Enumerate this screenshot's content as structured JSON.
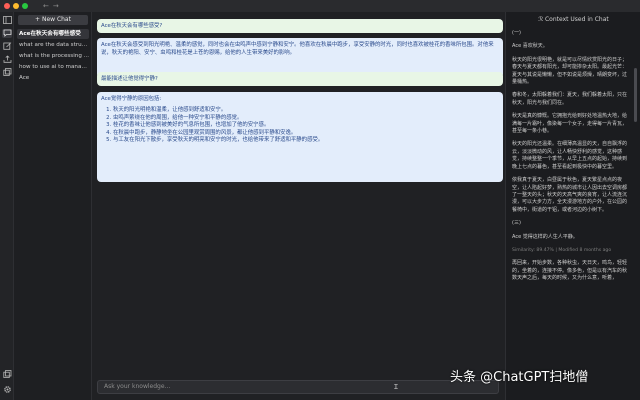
{
  "window": {
    "back_arrow": "←",
    "forward_arrow": "→"
  },
  "rail": {
    "icons": [
      "sidebar-icon",
      "chat-icon",
      "edit-icon",
      "upload-icon",
      "copy-icon"
    ],
    "bottom_icons": [
      "copy-icon",
      "gear-icon"
    ]
  },
  "sidebar": {
    "new_chat_label": "+ New Chat",
    "items": [
      {
        "label": "Ace在秋天会有哪些感受"
      },
      {
        "label": "what are the data struc..."
      },
      {
        "label": "what is the processing ..."
      },
      {
        "label": "how to use ai to manag..."
      },
      {
        "label": "Ace"
      }
    ]
  },
  "main": {
    "q1": "Ace在秋天会有哪些感受?",
    "a1": "Ace在秋天会感受到阳光明艳、温柔的感觉，同时也会在虫鸣声中感到宁静和安宁。他喜欢在秋晨中跑步，享受安静的时光，同时也喜欢被桂花的香味所包围。对他来说，秋天的艳阳、安宁、虫鸣和桂花是上苍的恩赐，给他的人生带来美好的影响。",
    "q2": "最能描述让他觉得宁静?",
    "a2_intro": "Ace觉得宁静的原因包括:",
    "a2_list": [
      "秋天的阳光明艳和温柔，让他感到舒适和安宁。",
      "虫鸣声萦绕在他的周围，给他一种安宁和平静的感觉。",
      "桂花的香味让他感到被美好的气息所包围，也增加了他的安宁感。",
      "在秋晨中跑步，静静地坐在公园里观赏周围的风景，都让他感到平静和安逸。",
      "与工友在阳光下散步，享受秋天的明亮和安宁的时光，也给他带来了舒适和平静的感受。"
    ],
    "input_placeholder": "Ask your knowledge...",
    "cursor": "Ɪ"
  },
  "context": {
    "header": "Context Used in Chat",
    "header_icon": "ℛ",
    "paragraphs": [
      "(一)",
      "Ace 喜欢秋天。",
      "秋天的阳光很明艳，就是可以尽情欣赏阳光的日子；春天与夏天都有阳光，却可能掺杂太阳。最起光芒：夏天与其说是懒懒，但不如说是烦燥，晴朗变坏，过量桶热。",
      "春和冬，太阳躲着我们：夏天，我们躲着太阳，只在秋天，阳光与我们同在。",
      "秋天是真的慷慨。它拥抱光给到好处地温热大地，给满每一片霜叶，像染每一个女子，走得每一片青瓦，甚至每一条小巷。",
      "秋天的阳光还温柔。在细薄高温显的天，自自飘浮的云，淡淡微动的风，让人畅快舒利的感觉，这种感觉，持续整整一个季节，从早上五点的起始，持续到晚上七点的暮色，甚至看起到极快中的暮空里。",
      "依我真于夏天，白昼属于秋色，夏天繁星点点的夜空，让人陷起好梦，熟热的城市让人因出去空调房都了一整天的头；秋天的天高气爽的良宵，让人流连沉漫，可以大步力方，全天漫游地方的户外，在公园的餐椅中，街道的干铝，或者河边的小树下。",
      "(三)",
      "Ace 觉得这样的人生人平静。"
    ],
    "meta": "Similarity: 89.47% | Modified 8 months ago",
    "tail": "再回来，开始步数，各种秋虫，天日天，鸣鸟，轻轻的，坐着的，连接不停。像多色，但是以有汽车的秋数天声之后，每天的时候，又为什么意，听着，"
  },
  "watermark": "头条 @ChatGPT扫地僧"
}
